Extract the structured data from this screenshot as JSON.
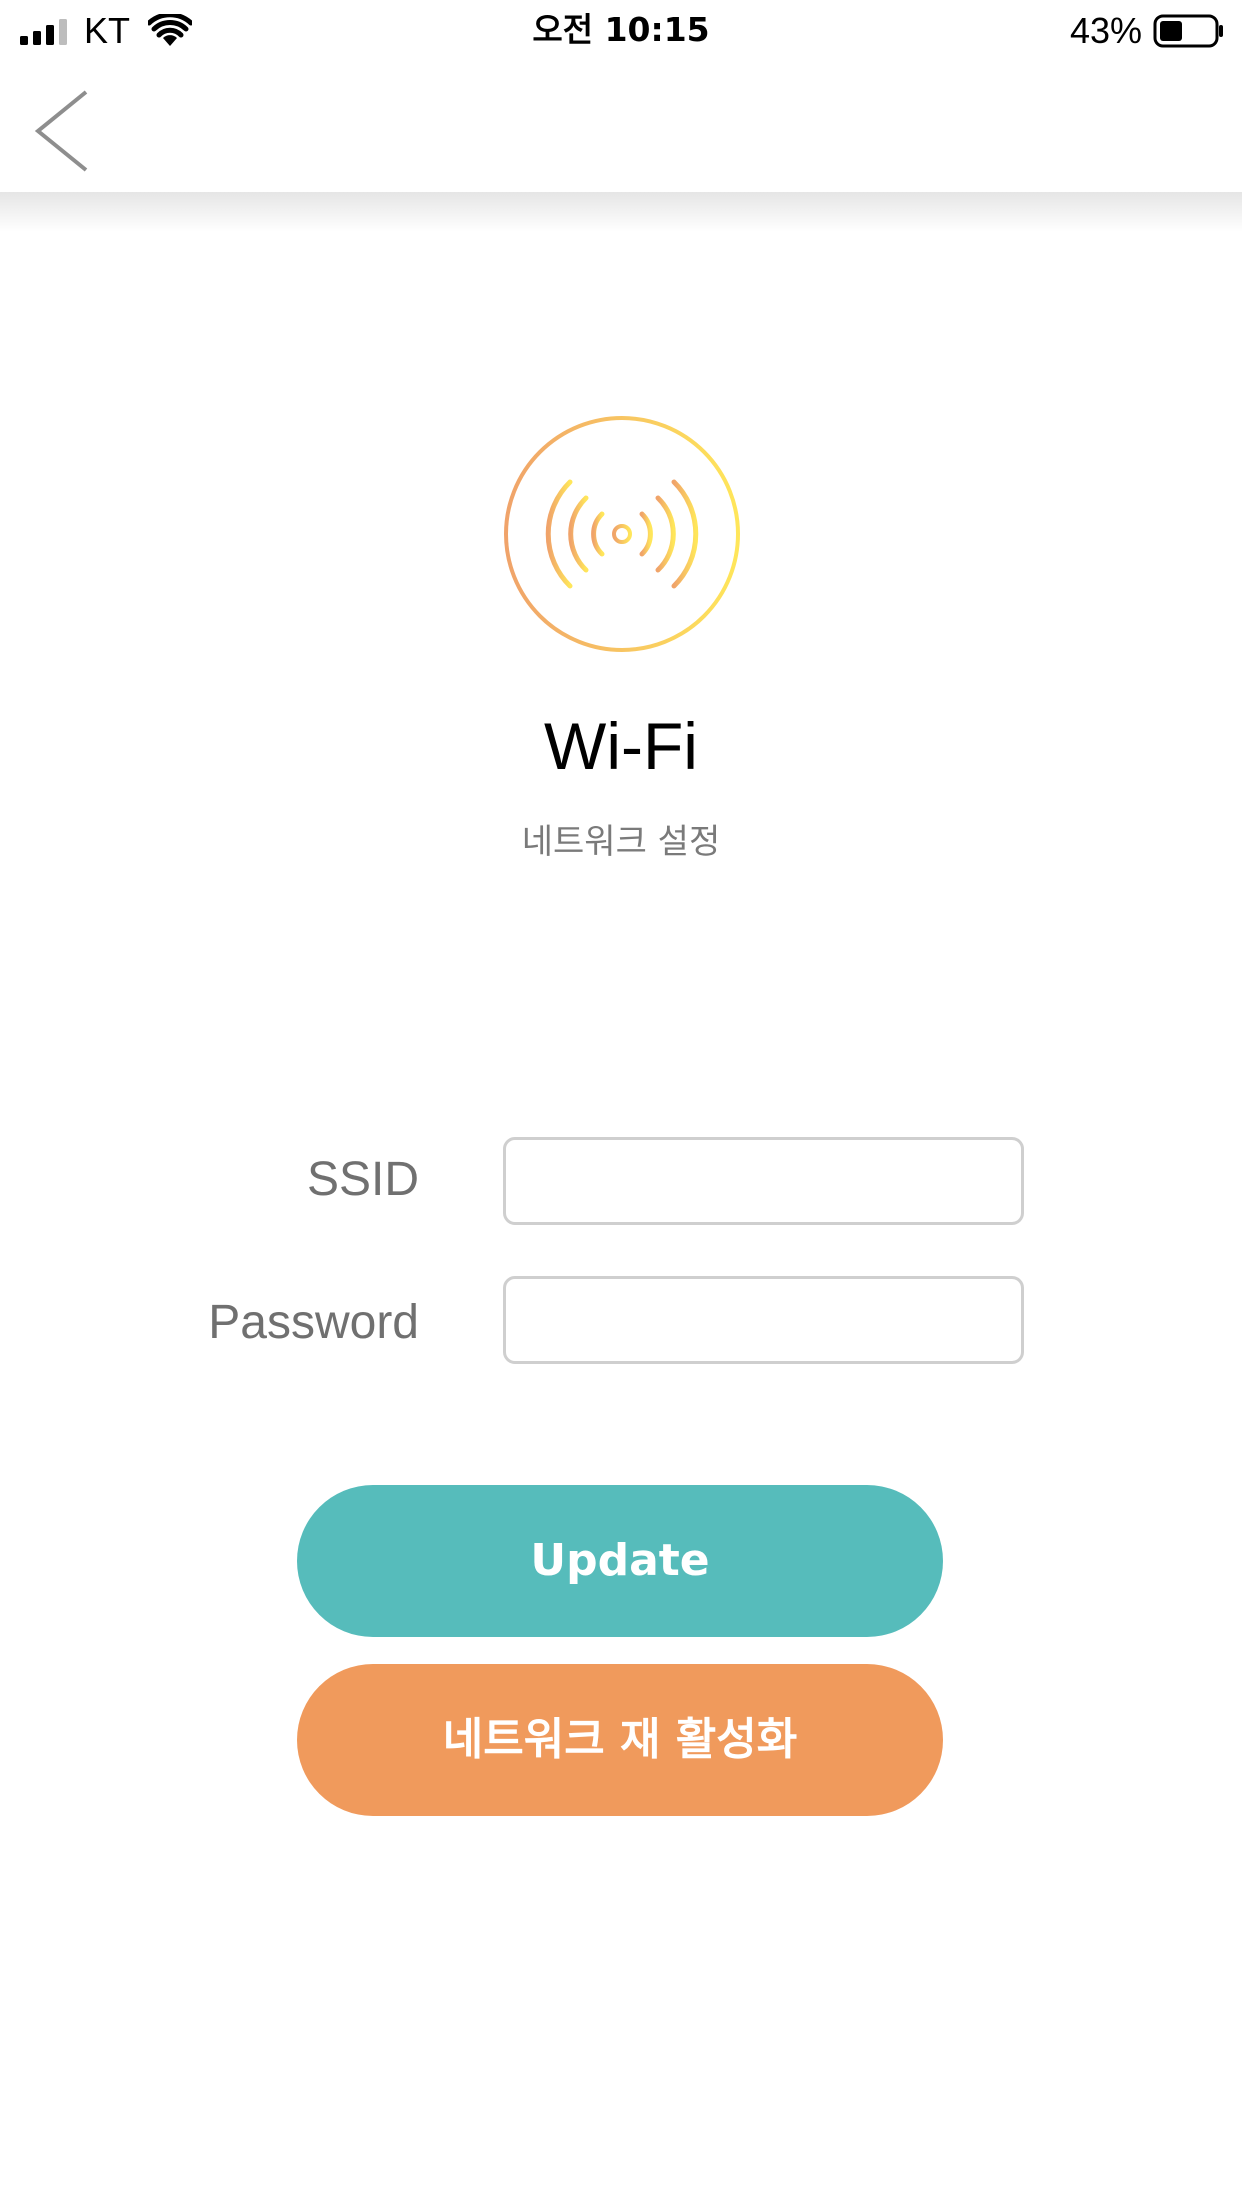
{
  "status_bar": {
    "carrier": "KT",
    "time": "오전 10:15",
    "battery_percent": "43%",
    "battery_level": 0.43,
    "icons": [
      "signal-icon",
      "wifi-icon",
      "battery-icon"
    ]
  },
  "nav": {
    "back_icon": "chevron-left-icon"
  },
  "hero": {
    "icon": "wifi-broadcast-icon",
    "title": "Wi-Fi",
    "subtitle": "네트워크 설정"
  },
  "form": {
    "ssid_label": "SSID",
    "ssid_value": "",
    "password_label": "Password",
    "password_value": ""
  },
  "buttons": {
    "update_label": "Update",
    "reactivate_label": "네트워크 재 활성화"
  },
  "colors": {
    "update_button": "#56bcbb",
    "reactivate_button": "#f09a5c",
    "emblem_gradient_start": "#f0a36a",
    "emblem_gradient_end": "#ffe65a"
  }
}
